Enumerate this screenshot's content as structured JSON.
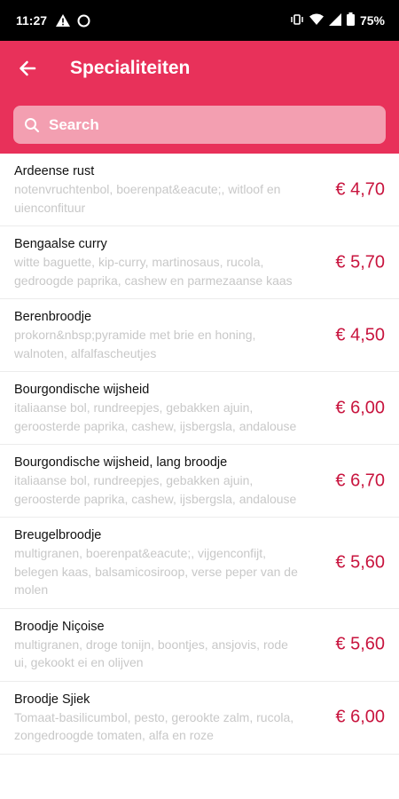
{
  "status_bar": {
    "time": "11:27",
    "battery": "75%"
  },
  "header": {
    "title": "Specialiteiten",
    "search_placeholder": "Search"
  },
  "colors": {
    "accent": "#e8315a",
    "price": "#c8143e"
  },
  "items": [
    {
      "name": "Ardeense rust",
      "description": "notenvruchtenbol, boerenpat&eacute;, witloof en uienconfituur",
      "price": "€ 4,70"
    },
    {
      "name": "Bengaalse curry",
      "description": "witte baguette, kip-curry, martinosaus, rucola, gedroogde paprika, cashew en parmezaanse kaas",
      "price": "€ 5,70"
    },
    {
      "name": "Berenbroodje",
      "description": "prokorn&nbsp;pyramide met brie en honing, walnoten, alfalfascheutjes",
      "price": "€ 4,50"
    },
    {
      "name": "Bourgondische wijsheid",
      "description": "italiaanse bol, rundreepjes, gebakken ajuin, geroosterde paprika, cashew, ijsbergsla, andalouse",
      "price": "€ 6,00"
    },
    {
      "name": "Bourgondische wijsheid, lang broodje",
      "description": "italiaanse bol, rundreepjes, gebakken ajuin, geroosterde paprika, cashew, ijsbergsla, andalouse",
      "price": "€ 6,70"
    },
    {
      "name": "Breugelbroodje",
      "description": "multigranen, boerenpat&eacute;, vijgenconfijt, belegen kaas, balsamicosiroop, verse peper van de molen",
      "price": "€ 5,60"
    },
    {
      "name": "Broodje Niçoise",
      "description": "multigranen, droge tonijn, boontjes, ansjovis, rode ui, gekookt ei en olijven",
      "price": "€ 5,60"
    },
    {
      "name": "Broodje Sjiek",
      "description": "Tomaat-basilicumbol, pesto, gerookte zalm, rucola, zongedroogde tomaten, alfa en roze",
      "price": "€ 6,00"
    }
  ]
}
